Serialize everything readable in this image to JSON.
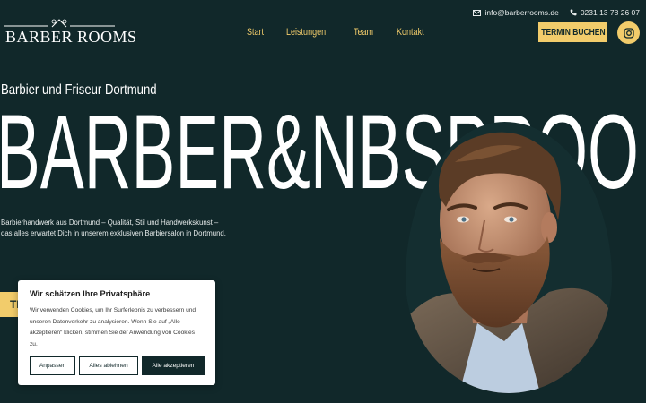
{
  "logo": {
    "text": "BARBER ROOMS"
  },
  "nav": {
    "items": [
      "Start",
      "Leistungen",
      "Team",
      "Kontakt"
    ]
  },
  "contact": {
    "email": "info@barberrooms.de",
    "phone": "0231 13 78 26 07"
  },
  "header": {
    "book_button": "TERMIN BUCHEN"
  },
  "hero": {
    "subtitle": "Barbier und Friseur Dortmund",
    "big_text": "BARBER&NBSPROO",
    "description": "Barbierhandwerk aus Dortmund – Qualität, Stil und Handwerkskunst – das alles erwartet Dich in unserem exklusiven Barbiersalon in Dortmund.",
    "cta_partial": "TE"
  },
  "cookie": {
    "title": "Wir schätzen Ihre Privatsphäre",
    "text": "Wir verwenden Cookies, um Ihr Surferlebnis zu verbessern und unseren Datenverkehr zu analysieren. Wenn Sie auf „Alle akzeptieren“ klicken, stimmen Sie der Anwendung von Cookies zu.",
    "customize": "Anpassen",
    "reject": "Alles ablehnen",
    "accept": "Alle akzeptieren"
  },
  "colors": {
    "background": "#11282a",
    "accent": "#f2cc6b",
    "text": "#ffffff"
  },
  "icons": {
    "email": "envelope-icon",
    "phone": "phone-icon",
    "social": "instagram-icon"
  }
}
